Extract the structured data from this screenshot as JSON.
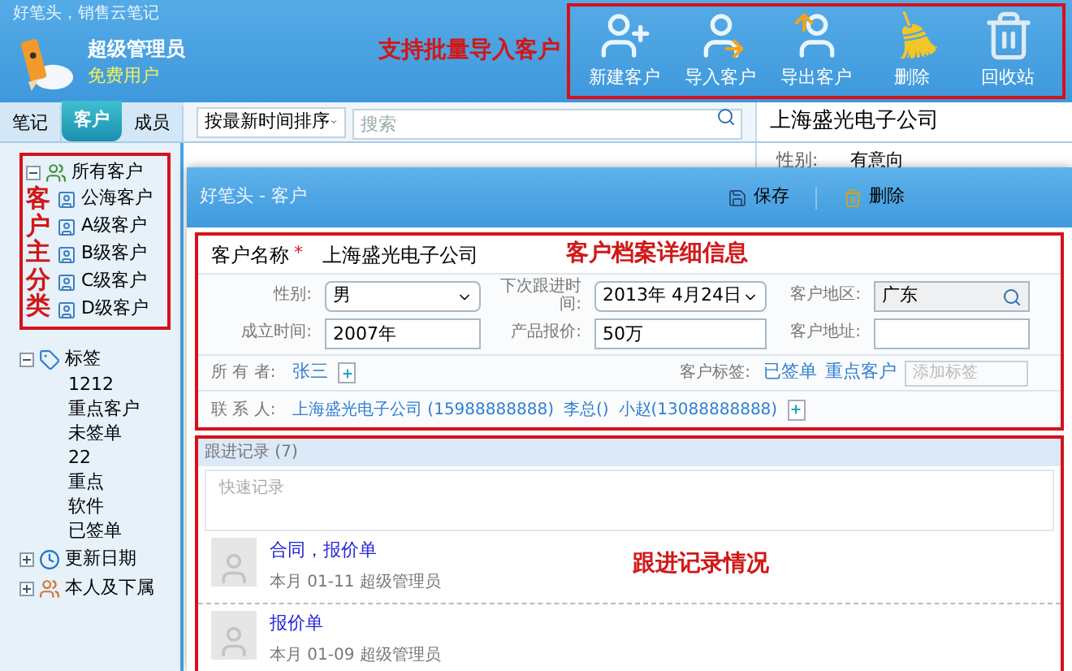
{
  "app": {
    "title": "好笔头，销售云笔记",
    "user_name": "超级管理员",
    "user_plan": "免费用户"
  },
  "header_note": "支持批量导入客户",
  "toolbar": [
    {
      "label": "新建客户",
      "kind": "add"
    },
    {
      "label": "导入客户",
      "kind": "import"
    },
    {
      "label": "导出客户",
      "kind": "export"
    },
    {
      "label": "删除",
      "kind": "delete"
    },
    {
      "label": "回收站",
      "kind": "trash"
    }
  ],
  "tabs": [
    {
      "label": "笔记",
      "selected": false
    },
    {
      "label": "客户",
      "selected": true
    },
    {
      "label": "成员",
      "selected": false
    }
  ],
  "sort": {
    "value": "按最新时间排序"
  },
  "search": {
    "placeholder": "搜索"
  },
  "background_detail": {
    "title": "上海盛光电子公司",
    "field_label": "性别:",
    "field_value": "有意向"
  },
  "sidebar": {
    "groups": [
      {
        "label": "所有客户",
        "kind": "customers",
        "expanded": true,
        "note": "客户主分类",
        "children": [
          {
            "label": "公海客户"
          },
          {
            "label": "A级客户"
          },
          {
            "label": "B级客户"
          },
          {
            "label": "C级客户"
          },
          {
            "label": "D级客户"
          }
        ]
      },
      {
        "label": "标签",
        "kind": "tags",
        "expanded": true,
        "children": [
          {
            "label": "1212"
          },
          {
            "label": "重点客户"
          },
          {
            "label": "未签单"
          },
          {
            "label": "22"
          },
          {
            "label": "重点"
          },
          {
            "label": "软件"
          },
          {
            "label": "已签单"
          }
        ]
      },
      {
        "label": "更新日期",
        "kind": "date",
        "expanded": false
      },
      {
        "label": "本人及下属",
        "kind": "people",
        "expanded": false
      }
    ]
  },
  "dialog": {
    "title": "好笔头 - 客户",
    "actions": [
      {
        "label": "保存",
        "kind": "save"
      },
      {
        "label": "删除",
        "kind": "delete"
      }
    ],
    "name_label": "客户名称",
    "required_mark": "*",
    "name_value": "上海盛光电子公司",
    "note": "客户档案详细信息",
    "fields": [
      {
        "label": "性别:",
        "value": "男",
        "kind": "select"
      },
      {
        "label": "下次跟进时间:",
        "value": "2013年 4月24日",
        "kind": "select"
      },
      {
        "label": "客户地区:",
        "value": "广东",
        "kind": "search"
      },
      {
        "label": "成立时间:",
        "value": "2007年",
        "kind": "text"
      },
      {
        "label": "产品报价:",
        "value": "50万",
        "kind": "text"
      },
      {
        "label": "客户地址:",
        "kind": "text"
      }
    ],
    "owner": {
      "label": "所 有 者:",
      "name": "张三"
    },
    "tags": {
      "label": "客户标签:",
      "items": [
        "已签单",
        "重点客户"
      ],
      "placeholder": "添加标签"
    },
    "contacts": {
      "label": "联 系 人:",
      "items": [
        "上海盛光电子公司 (15988888888)",
        "李总()",
        "小赵(13088888888)"
      ]
    },
    "records": {
      "title": "跟进记录 (7)",
      "placeholder": "快速记录",
      "note": "跟进记录情况",
      "items": [
        {
          "title": "合同，报价单",
          "meta": "本月 01-11 超级管理员"
        },
        {
          "title": "报价单",
          "meta": "本月 01-09 超级管理员"
        }
      ]
    }
  }
}
